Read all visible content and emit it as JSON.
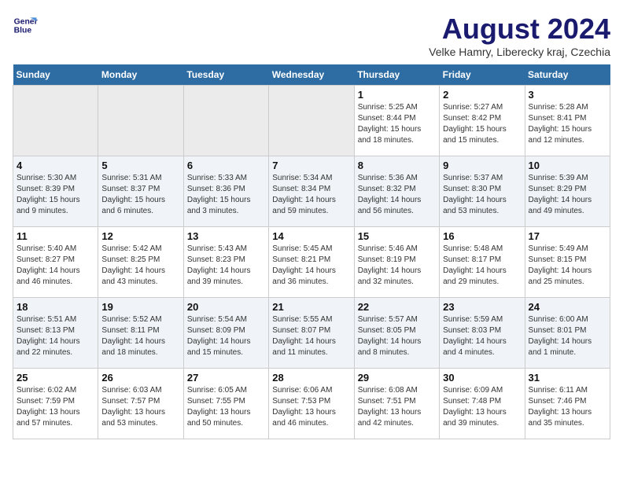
{
  "header": {
    "logo_line1": "General",
    "logo_line2": "Blue",
    "title": "August 2024",
    "subtitle": "Velke Hamry, Liberecky kraj, Czechia"
  },
  "calendar": {
    "weekdays": [
      "Sunday",
      "Monday",
      "Tuesday",
      "Wednesday",
      "Thursday",
      "Friday",
      "Saturday"
    ],
    "weeks": [
      [
        {
          "day": "",
          "empty": true
        },
        {
          "day": "",
          "empty": true
        },
        {
          "day": "",
          "empty": true
        },
        {
          "day": "",
          "empty": true
        },
        {
          "day": "1",
          "sunrise": "Sunrise: 5:25 AM",
          "sunset": "Sunset: 8:44 PM",
          "daylight": "Daylight: 15 hours and 18 minutes."
        },
        {
          "day": "2",
          "sunrise": "Sunrise: 5:27 AM",
          "sunset": "Sunset: 8:42 PM",
          "daylight": "Daylight: 15 hours and 15 minutes."
        },
        {
          "day": "3",
          "sunrise": "Sunrise: 5:28 AM",
          "sunset": "Sunset: 8:41 PM",
          "daylight": "Daylight: 15 hours and 12 minutes."
        }
      ],
      [
        {
          "day": "4",
          "sunrise": "Sunrise: 5:30 AM",
          "sunset": "Sunset: 8:39 PM",
          "daylight": "Daylight: 15 hours and 9 minutes."
        },
        {
          "day": "5",
          "sunrise": "Sunrise: 5:31 AM",
          "sunset": "Sunset: 8:37 PM",
          "daylight": "Daylight: 15 hours and 6 minutes."
        },
        {
          "day": "6",
          "sunrise": "Sunrise: 5:33 AM",
          "sunset": "Sunset: 8:36 PM",
          "daylight": "Daylight: 15 hours and 3 minutes."
        },
        {
          "day": "7",
          "sunrise": "Sunrise: 5:34 AM",
          "sunset": "Sunset: 8:34 PM",
          "daylight": "Daylight: 14 hours and 59 minutes."
        },
        {
          "day": "8",
          "sunrise": "Sunrise: 5:36 AM",
          "sunset": "Sunset: 8:32 PM",
          "daylight": "Daylight: 14 hours and 56 minutes."
        },
        {
          "day": "9",
          "sunrise": "Sunrise: 5:37 AM",
          "sunset": "Sunset: 8:30 PM",
          "daylight": "Daylight: 14 hours and 53 minutes."
        },
        {
          "day": "10",
          "sunrise": "Sunrise: 5:39 AM",
          "sunset": "Sunset: 8:29 PM",
          "daylight": "Daylight: 14 hours and 49 minutes."
        }
      ],
      [
        {
          "day": "11",
          "sunrise": "Sunrise: 5:40 AM",
          "sunset": "Sunset: 8:27 PM",
          "daylight": "Daylight: 14 hours and 46 minutes."
        },
        {
          "day": "12",
          "sunrise": "Sunrise: 5:42 AM",
          "sunset": "Sunset: 8:25 PM",
          "daylight": "Daylight: 14 hours and 43 minutes."
        },
        {
          "day": "13",
          "sunrise": "Sunrise: 5:43 AM",
          "sunset": "Sunset: 8:23 PM",
          "daylight": "Daylight: 14 hours and 39 minutes."
        },
        {
          "day": "14",
          "sunrise": "Sunrise: 5:45 AM",
          "sunset": "Sunset: 8:21 PM",
          "daylight": "Daylight: 14 hours and 36 minutes."
        },
        {
          "day": "15",
          "sunrise": "Sunrise: 5:46 AM",
          "sunset": "Sunset: 8:19 PM",
          "daylight": "Daylight: 14 hours and 32 minutes."
        },
        {
          "day": "16",
          "sunrise": "Sunrise: 5:48 AM",
          "sunset": "Sunset: 8:17 PM",
          "daylight": "Daylight: 14 hours and 29 minutes."
        },
        {
          "day": "17",
          "sunrise": "Sunrise: 5:49 AM",
          "sunset": "Sunset: 8:15 PM",
          "daylight": "Daylight: 14 hours and 25 minutes."
        }
      ],
      [
        {
          "day": "18",
          "sunrise": "Sunrise: 5:51 AM",
          "sunset": "Sunset: 8:13 PM",
          "daylight": "Daylight: 14 hours and 22 minutes."
        },
        {
          "day": "19",
          "sunrise": "Sunrise: 5:52 AM",
          "sunset": "Sunset: 8:11 PM",
          "daylight": "Daylight: 14 hours and 18 minutes."
        },
        {
          "day": "20",
          "sunrise": "Sunrise: 5:54 AM",
          "sunset": "Sunset: 8:09 PM",
          "daylight": "Daylight: 14 hours and 15 minutes."
        },
        {
          "day": "21",
          "sunrise": "Sunrise: 5:55 AM",
          "sunset": "Sunset: 8:07 PM",
          "daylight": "Daylight: 14 hours and 11 minutes."
        },
        {
          "day": "22",
          "sunrise": "Sunrise: 5:57 AM",
          "sunset": "Sunset: 8:05 PM",
          "daylight": "Daylight: 14 hours and 8 minutes."
        },
        {
          "day": "23",
          "sunrise": "Sunrise: 5:59 AM",
          "sunset": "Sunset: 8:03 PM",
          "daylight": "Daylight: 14 hours and 4 minutes."
        },
        {
          "day": "24",
          "sunrise": "Sunrise: 6:00 AM",
          "sunset": "Sunset: 8:01 PM",
          "daylight": "Daylight: 14 hours and 1 minute."
        }
      ],
      [
        {
          "day": "25",
          "sunrise": "Sunrise: 6:02 AM",
          "sunset": "Sunset: 7:59 PM",
          "daylight": "Daylight: 13 hours and 57 minutes."
        },
        {
          "day": "26",
          "sunrise": "Sunrise: 6:03 AM",
          "sunset": "Sunset: 7:57 PM",
          "daylight": "Daylight: 13 hours and 53 minutes."
        },
        {
          "day": "27",
          "sunrise": "Sunrise: 6:05 AM",
          "sunset": "Sunset: 7:55 PM",
          "daylight": "Daylight: 13 hours and 50 minutes."
        },
        {
          "day": "28",
          "sunrise": "Sunrise: 6:06 AM",
          "sunset": "Sunset: 7:53 PM",
          "daylight": "Daylight: 13 hours and 46 minutes."
        },
        {
          "day": "29",
          "sunrise": "Sunrise: 6:08 AM",
          "sunset": "Sunset: 7:51 PM",
          "daylight": "Daylight: 13 hours and 42 minutes."
        },
        {
          "day": "30",
          "sunrise": "Sunrise: 6:09 AM",
          "sunset": "Sunset: 7:48 PM",
          "daylight": "Daylight: 13 hours and 39 minutes."
        },
        {
          "day": "31",
          "sunrise": "Sunrise: 6:11 AM",
          "sunset": "Sunset: 7:46 PM",
          "daylight": "Daylight: 13 hours and 35 minutes."
        }
      ]
    ]
  }
}
